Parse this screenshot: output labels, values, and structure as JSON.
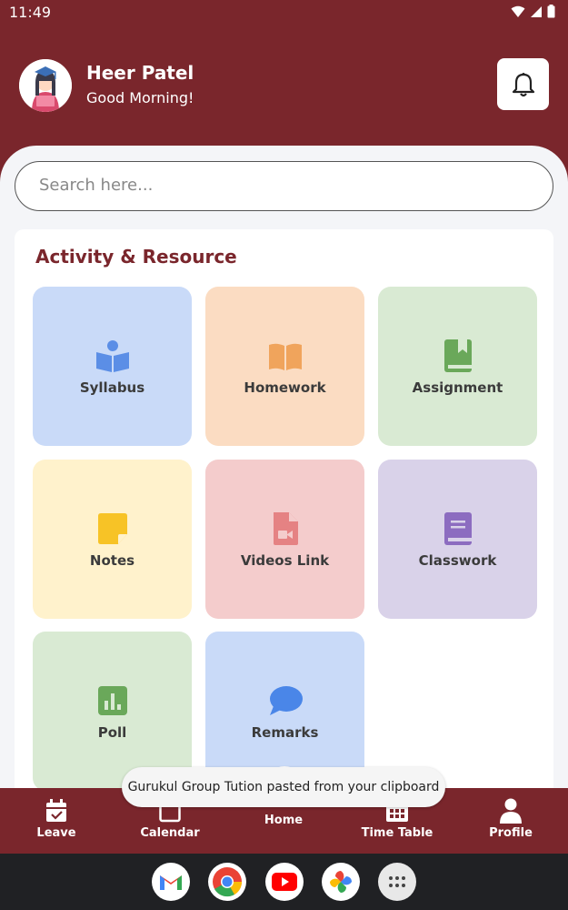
{
  "status_bar": {
    "time": "11:49"
  },
  "header": {
    "user_name": "Heer Patel",
    "greeting": "Good Morning!"
  },
  "search": {
    "placeholder": "Search here..."
  },
  "section": {
    "title": "Activity & Resource",
    "tiles": [
      {
        "label": "Syllabus",
        "icon": "reader-icon",
        "bg": "#c9daf8",
        "color": "#5b8ee6"
      },
      {
        "label": "Homework",
        "icon": "open-book-icon",
        "bg": "#fbdcc2",
        "color": "#f0a45c"
      },
      {
        "label": "Assignment",
        "icon": "bookmark-book-icon",
        "bg": "#d9ead3",
        "color": "#6aa85a"
      },
      {
        "label": "Notes",
        "icon": "sticky-note-icon",
        "bg": "#fff2cc",
        "color": "#f7c326"
      },
      {
        "label": "Videos Link",
        "icon": "video-file-icon",
        "bg": "#f4cccc",
        "color": "#e58283"
      },
      {
        "label": "Classwork",
        "icon": "notebook-icon",
        "bg": "#d9d2e9",
        "color": "#8c6cc0"
      },
      {
        "label": "Poll",
        "icon": "bar-chart-icon",
        "bg": "#d9ead3",
        "color": "#6aa85a"
      },
      {
        "label": "Remarks",
        "icon": "chat-bubble-icon",
        "bg": "#c9daf8",
        "color": "#4a86e8"
      }
    ]
  },
  "toast": {
    "text": "Gurukul Group Tution pasted from your clipboard"
  },
  "bottom_nav": {
    "items": [
      {
        "label": "Leave",
        "icon": "calendar-check-icon"
      },
      {
        "label": "Calendar",
        "icon": "calendar-icon"
      },
      {
        "label": "Home",
        "icon": "home-icon"
      },
      {
        "label": "Time Table",
        "icon": "grid-icon"
      },
      {
        "label": "Profile",
        "icon": "person-icon"
      }
    ]
  },
  "dock": {
    "apps": [
      "gmail-icon",
      "chrome-icon",
      "youtube-icon",
      "photos-icon",
      "app-drawer-icon"
    ]
  },
  "colors": {
    "brand": "#7a262c",
    "surface": "#f4f5f8"
  }
}
